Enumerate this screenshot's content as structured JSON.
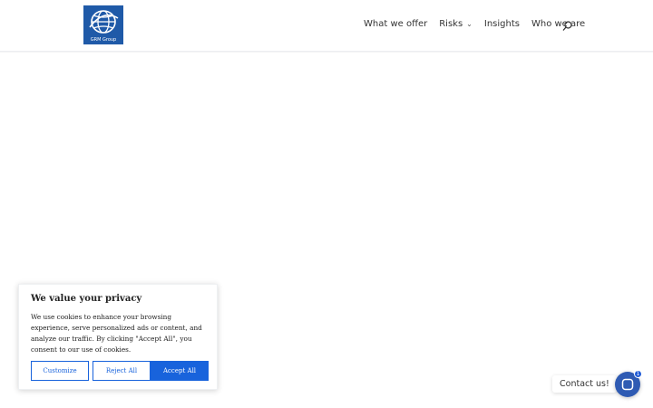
{
  "header": {
    "logo_text": "GRM Group",
    "nav": [
      {
        "label": "What we offer"
      },
      {
        "label": "Risks"
      },
      {
        "label": "Insights"
      },
      {
        "label": "Who we are"
      }
    ]
  },
  "cookie_banner": {
    "title": "We value your privacy",
    "body": "We use cookies to enhance your browsing experience, serve personalized ads or content, and analyze our traffic. By clicking \"Accept All\", you consent to our use of cookies.",
    "customize_label": "Customize",
    "reject_label": "Reject All",
    "accept_label": "Accept All",
    "accent_color": "#1863dc"
  },
  "contact": {
    "label": "Contact us!",
    "badge_count": "1",
    "bubble_color": "#2f5bb3"
  },
  "brand": {
    "logo_color": "#1f5aa8"
  }
}
